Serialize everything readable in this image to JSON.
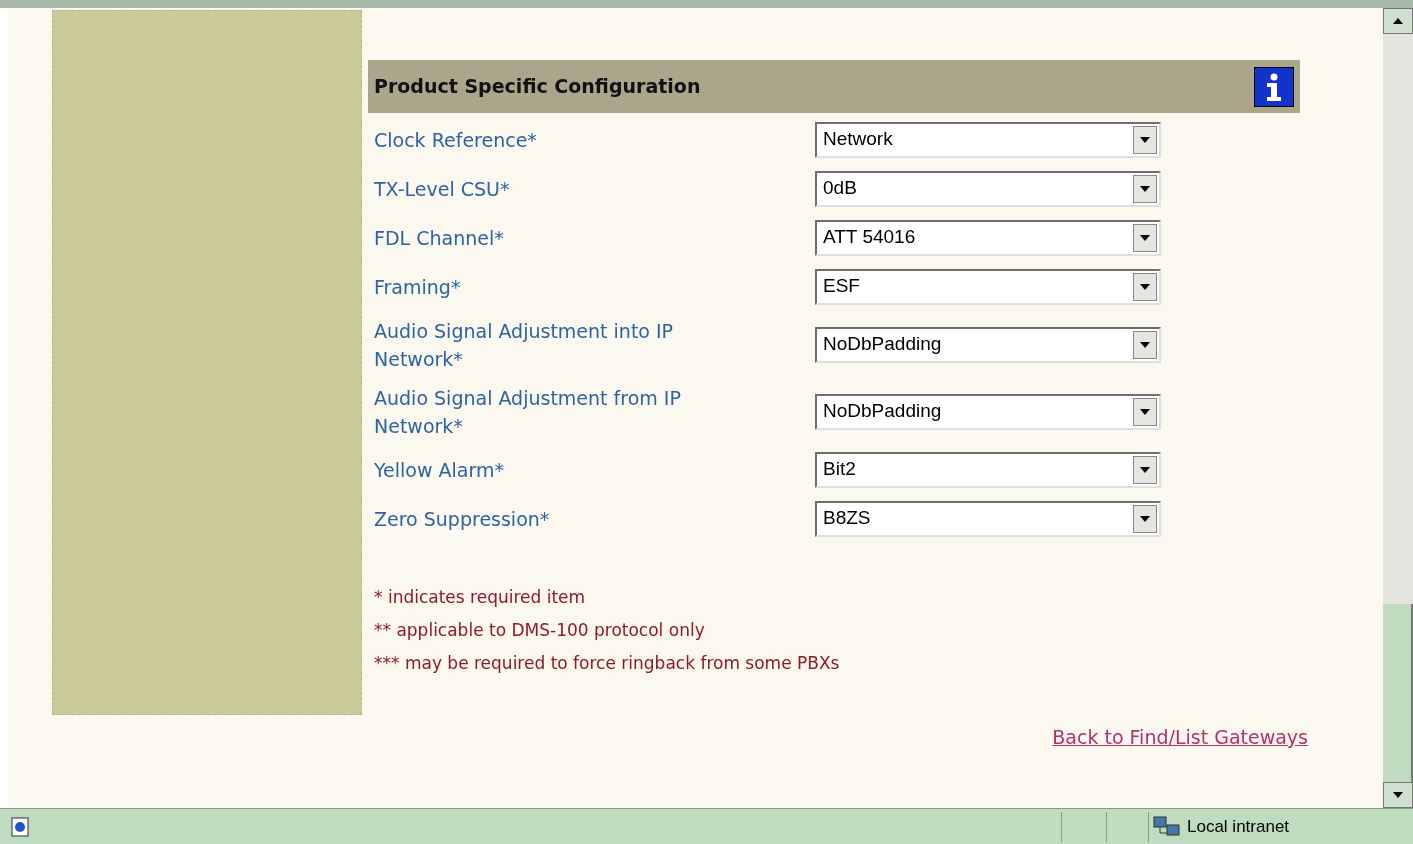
{
  "section": {
    "title": "Product Specific Configuration"
  },
  "fields": [
    {
      "label": "Clock Reference*",
      "value": "Network"
    },
    {
      "label": "TX-Level CSU*",
      "value": "0dB"
    },
    {
      "label": "FDL Channel*",
      "value": "ATT 54016"
    },
    {
      "label": "Framing*",
      "value": "ESF"
    },
    {
      "label": "Audio Signal Adjustment into IP Network*",
      "value": "NoDbPadding"
    },
    {
      "label": "Audio Signal Adjustment from IP Network*",
      "value": "NoDbPadding"
    },
    {
      "label": "Yellow Alarm*",
      "value": "Bit2"
    },
    {
      "label": "Zero Suppression*",
      "value": "B8ZS"
    }
  ],
  "notes": [
    "* indicates required item",
    "** applicable to DMS-100 protocol only",
    "*** may be required to force ringback from some PBXs"
  ],
  "link": "Back to Find/List Gateways",
  "status_bar": {
    "zone": "Local intranet"
  }
}
